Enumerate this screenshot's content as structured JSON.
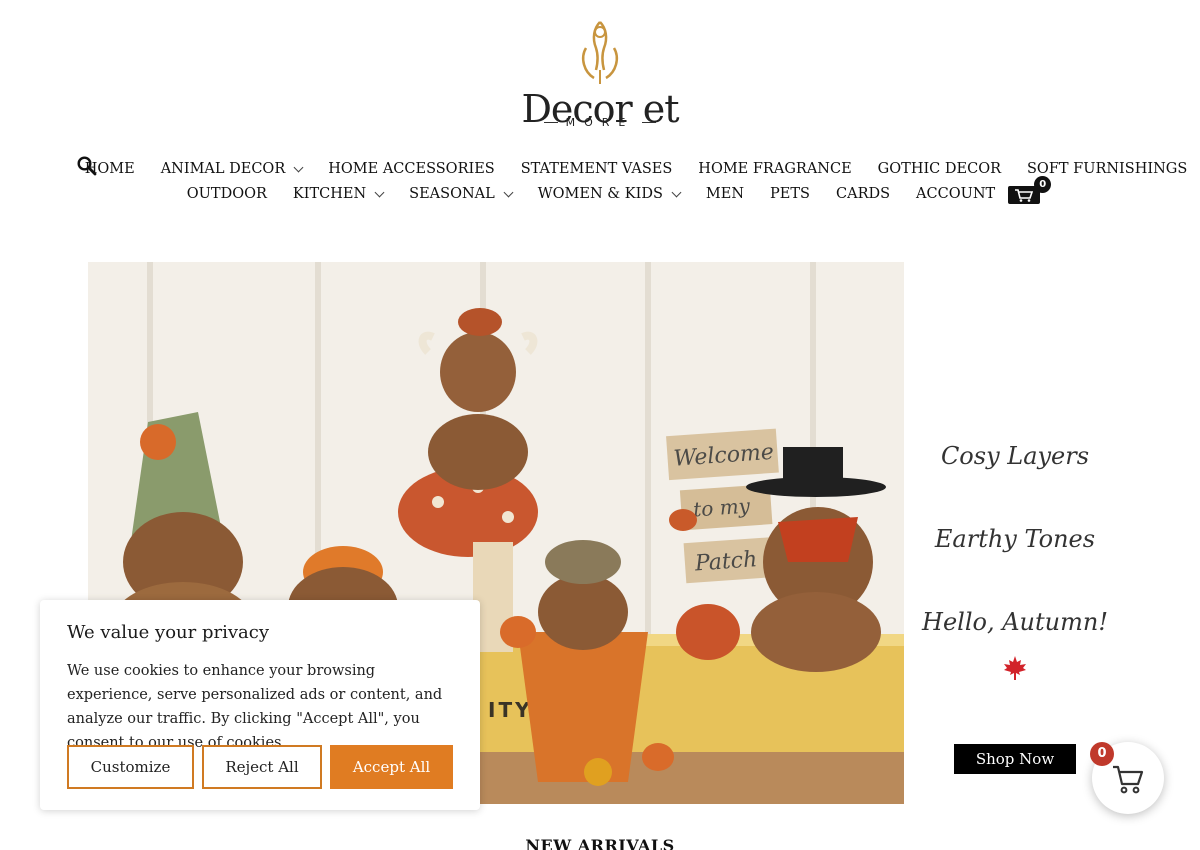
{
  "brand": {
    "name": "Decor et",
    "sub": "MORE",
    "gold": "#c8953f"
  },
  "nav": {
    "row1": [
      {
        "label": "HOME",
        "dropdown": false
      },
      {
        "label": "ANIMAL DECOR",
        "dropdown": true
      },
      {
        "label": "HOME ACCESSORIES",
        "dropdown": false
      },
      {
        "label": "STATEMENT VASES",
        "dropdown": false
      },
      {
        "label": "HOME FRAGRANCE",
        "dropdown": false
      },
      {
        "label": "GOTHIC DECOR",
        "dropdown": false
      },
      {
        "label": "SOFT FURNISHINGS",
        "dropdown": false
      }
    ],
    "row2": [
      {
        "label": "OUTDOOR",
        "dropdown": false
      },
      {
        "label": "KITCHEN",
        "dropdown": true
      },
      {
        "label": "SEASONAL",
        "dropdown": true
      },
      {
        "label": "WOMEN & KIDS",
        "dropdown": true
      },
      {
        "label": "MEN",
        "dropdown": false
      },
      {
        "label": "PETS",
        "dropdown": false
      },
      {
        "label": "CARDS",
        "dropdown": false
      },
      {
        "label": "ACCOUNT",
        "dropdown": false
      }
    ],
    "cart_count": "0",
    "search_icon": "search-icon",
    "cart_icon": "cart-icon"
  },
  "hero": {
    "taglines": [
      "Cosy Layers",
      "Earthy Tones",
      "Hello, Autumn!"
    ],
    "leaf_icon": "maple-leaf-icon",
    "leaf_color": "#d2232a",
    "cta": "Shop Now",
    "sign_lines": [
      "Welcome",
      "to my",
      "Patch"
    ],
    "book_text": "ITY        COAST"
  },
  "floating_cart": {
    "count": "0",
    "badge_color": "#c0392b"
  },
  "section": {
    "title": "NEW ARRIVALS"
  },
  "cookie": {
    "title": "We value your privacy",
    "body": "We use cookies to enhance your browsing experience, serve personalized ads or content, and analyze our traffic. By clicking \"Accept All\", you consent to our use of cookies.",
    "customize": "Customize",
    "reject": "Reject All",
    "accept": "Accept All",
    "accent": "#e07c22"
  }
}
